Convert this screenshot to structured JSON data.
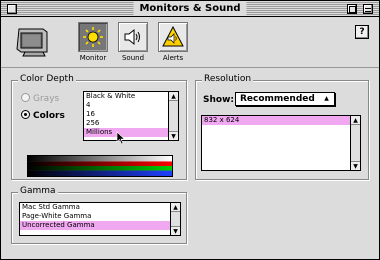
{
  "window": {
    "title": "Monitors & Sound"
  },
  "toolbar": {
    "tools": [
      {
        "label": "Monitor",
        "icon": "monitor-sun-icon",
        "selected": true
      },
      {
        "label": "Sound",
        "icon": "speaker-icon",
        "selected": false
      },
      {
        "label": "Alerts",
        "icon": "alert-speaker-icon",
        "selected": false
      }
    ],
    "help": "?"
  },
  "color_depth": {
    "title": "Color Depth",
    "grays_label": "Grays",
    "colors_label": "Colors",
    "items": [
      "Black & White",
      "4",
      "16",
      "256",
      "Millions"
    ],
    "selected": "Millions"
  },
  "resolution": {
    "title": "Resolution",
    "show_label": "Show:",
    "show_value": "Recommended",
    "items": [
      "832 x 624"
    ],
    "selected": "832 x 624"
  },
  "gamma": {
    "title": "Gamma",
    "items": [
      "Mac Std Gamma",
      "Page-White Gamma",
      "Uncorrected Gamma"
    ],
    "selected": "Uncorrected Gamma"
  },
  "colors": {
    "selection": "#f0a8f0",
    "window": "#dcdcdc"
  }
}
